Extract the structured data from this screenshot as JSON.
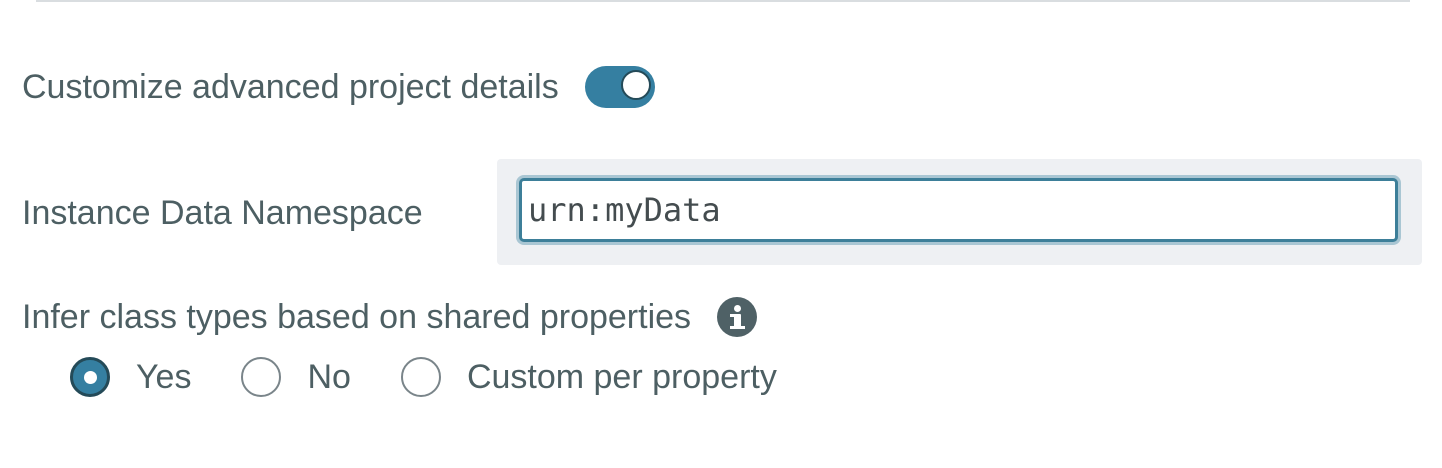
{
  "advanced": {
    "label": "Customize advanced project details",
    "enabled": true
  },
  "namespace": {
    "label": "Instance Data Namespace",
    "value": "urn:myData"
  },
  "infer": {
    "label": "Infer class types based on shared properties",
    "info_icon": "info-icon",
    "options": [
      {
        "label": "Yes",
        "checked": true
      },
      {
        "label": "No",
        "checked": false
      },
      {
        "label": "Custom per property",
        "checked": false
      }
    ]
  },
  "colors": {
    "accent": "#357fa1",
    "text": "#4d5f63",
    "panel": "#eef0f3"
  }
}
